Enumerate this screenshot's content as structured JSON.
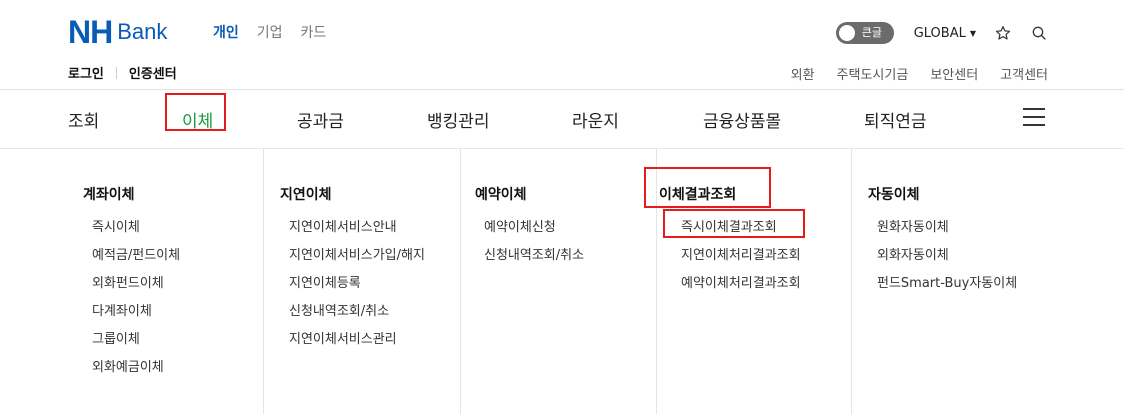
{
  "brand": {
    "nh": "NH",
    "bank": "Bank"
  },
  "customer_tabs": [
    {
      "label": "개인",
      "active": true
    },
    {
      "label": "기업",
      "active": false
    },
    {
      "label": "카드",
      "active": false
    }
  ],
  "utility": {
    "toggle_label": "큰글",
    "global_label": "GLOBAL"
  },
  "login": {
    "login_label": "로그인",
    "cert_label": "인증센터"
  },
  "util_links": [
    "외환",
    "주택도시기금",
    "보안센터",
    "고객센터"
  ],
  "nav": [
    "조회",
    "이체",
    "공과금",
    "뱅킹관리",
    "라운지",
    "금융상품몰",
    "퇴직연금"
  ],
  "colors": {
    "brand_blue": "#0a5bb8",
    "active_green": "#1a9a3c",
    "highlight_red": "#e31c1c"
  },
  "mega_menu": [
    {
      "title": "계좌이체",
      "items": [
        "즉시이체",
        "예적금/펀드이체",
        "외화펀드이체",
        "다계좌이체",
        "그룹이체",
        "외화예금이체"
      ]
    },
    {
      "title": "지연이체",
      "items": [
        "지연이체서비스안내",
        "지연이체서비스가입/해지",
        "지연이체등록",
        "신청내역조회/취소",
        "지연이체서비스관리"
      ]
    },
    {
      "title": "예약이체",
      "items": [
        "예약이체신청",
        "신청내역조회/취소"
      ]
    },
    {
      "title": "이체결과조회",
      "items": [
        "즉시이체결과조회",
        "지연이체처리결과조회",
        "예약이체처리결과조회"
      ]
    },
    {
      "title": "자동이체",
      "items": [
        "원화자동이체",
        "외화자동이체",
        "펀드Smart-Buy자동이체"
      ]
    }
  ]
}
